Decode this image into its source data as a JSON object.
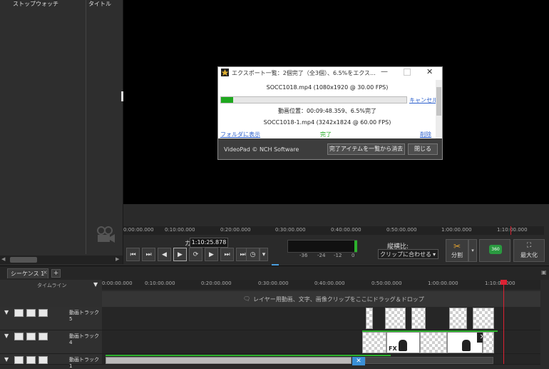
{
  "library": {
    "columns": [
      "ストップウォッチ",
      "タイトル"
    ]
  },
  "preview": {
    "ruler_ticks": [
      "0:00:00.000",
      "0:10:00.000",
      "0:20:00.000",
      "0:30:00.000",
      "0:40:00.000",
      "0:50:00.000",
      "1:00:00.000",
      "1:10:00.000"
    ],
    "cursor_label": "カーソル:",
    "cursor_value": "1:10:25.878",
    "meter_labels": [
      "-36",
      "-24",
      "-12",
      "0"
    ],
    "aspect_label": "縦横比:",
    "aspect_value": "クリップに合わせる",
    "split_label": "分割",
    "vr_label": "360",
    "maximize_label": "最大化"
  },
  "export_dialog": {
    "title": "エクスポート一覧：2個完了（全3個）、6.5%をエクス...",
    "file1": "SOCC1018.mp4 (1080x1920 @ 30.00 FPS)",
    "progress": 0.065,
    "cancel": "キャンセル",
    "position_text": "動画位置：00:09:48.359、6.5%完了",
    "file2": "SOCC1018-1.mp4 (3242x1824 @ 60.00 FPS)",
    "open_folder": "フォルダに表示",
    "status": "完了",
    "delete": "削除",
    "brand": "VideoPad © NCH Software",
    "clear_button": "完了アイテムを一覧から消去",
    "close_button": "閉じる"
  },
  "timeline": {
    "sequence_tab": "シーケンス 1",
    "tab_close": "×",
    "add_tab": "+",
    "timeline_label": "タイムライン",
    "ruler_ticks": [
      "0:00:00.000",
      "0:10:00.000",
      "0:20:00.000",
      "0:30:00.000",
      "0:40:00.000",
      "0:50:00.000",
      "1:00:00.000",
      "1:10:00.000"
    ],
    "drop_hint": "レイヤー用動画、文字、画像クリップをここにドラッグ＆ドロップ",
    "tracks": [
      {
        "name": "動画トラック 5"
      },
      {
        "name": "動画トラック 4"
      },
      {
        "name": "動画トラック 1"
      }
    ],
    "fx_label": "FX"
  },
  "colors": {
    "progress_green": "#1ea81e",
    "link_blue": "#2b5fcc",
    "playhead_red": "#dd2233"
  }
}
